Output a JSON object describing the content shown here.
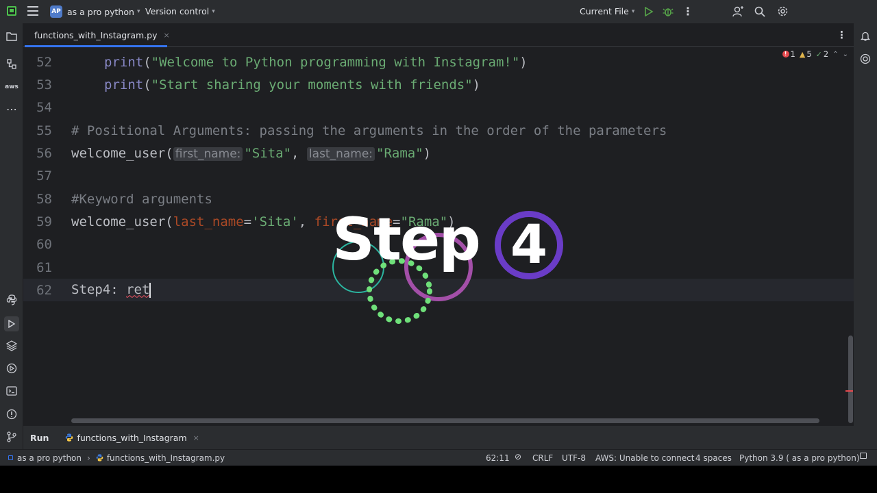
{
  "titlebar": {
    "project_badge": "AP",
    "project_name": "as a pro python",
    "vcs": "Version control",
    "run_config": "Current File"
  },
  "tab": {
    "filename": "functions_with_Instagram.py",
    "close": "×"
  },
  "inspection": {
    "errors": "1",
    "warnings": "5",
    "weak": "2"
  },
  "code": {
    "l52_num": "52",
    "l52_fn": "print",
    "l52_open": "(",
    "l52_str": "\"Welcome to Python programming with Instagram!\"",
    "l52_close": ")",
    "l53_num": "53",
    "l53_fn": "print",
    "l53_open": "(",
    "l53_str": "\"Start sharing your moments with friends\"",
    "l53_close": ")",
    "l54_num": "54",
    "l55_num": "55",
    "l55_comment": "# Positional Arguments: passing the arguments in the order of the parameters",
    "l56_num": "56",
    "l56_fn": "welcome_user(",
    "l56_hint1": "first_name:",
    "l56_arg1": "\"Sita\"",
    "l56_comma": ", ",
    "l56_hint2": "last_name:",
    "l56_arg2": "\"Rama\"",
    "l56_close": ")",
    "l57_num": "57",
    "l58_num": "58",
    "l58_comment": "#Keyword arguments",
    "l59_num": "59",
    "l59_fn": "welcome_user(",
    "l59_p1": "last_name",
    "l59_eq1": "=",
    "l59_v1": "'Sita'",
    "l59_comma": ", ",
    "l59_p2": "first_name",
    "l59_eq2": "=",
    "l59_v2": "\"Rama\"",
    "l59_close": ")",
    "l60_num": "60",
    "l61_num": "61",
    "l62_num": "62",
    "l62_label": "Step4: ",
    "l62_typed": "ret"
  },
  "bottom_panel": {
    "run_label": "Run",
    "run_tab": "functions_with_Instagram",
    "close": "×"
  },
  "statusbar": {
    "crumb_project": "as a pro python",
    "crumb_file": "functions_with_Instagram.py",
    "position": "62:11",
    "line_sep": "CRLF",
    "encoding": "UTF-8",
    "aws": "AWS: Unable to connect",
    "indent": "4 spaces",
    "interpreter": "Python 3.9 ( as a pro python)"
  },
  "overlay": {
    "step_word": "Step",
    "step_number": "4"
  },
  "colors": {
    "accent": "#3574f0",
    "string": "#6aab73",
    "keyword": "#8888c6",
    "comment": "#7a7e85",
    "param": "#aa4926",
    "step_ring": "#6a3cc7"
  }
}
